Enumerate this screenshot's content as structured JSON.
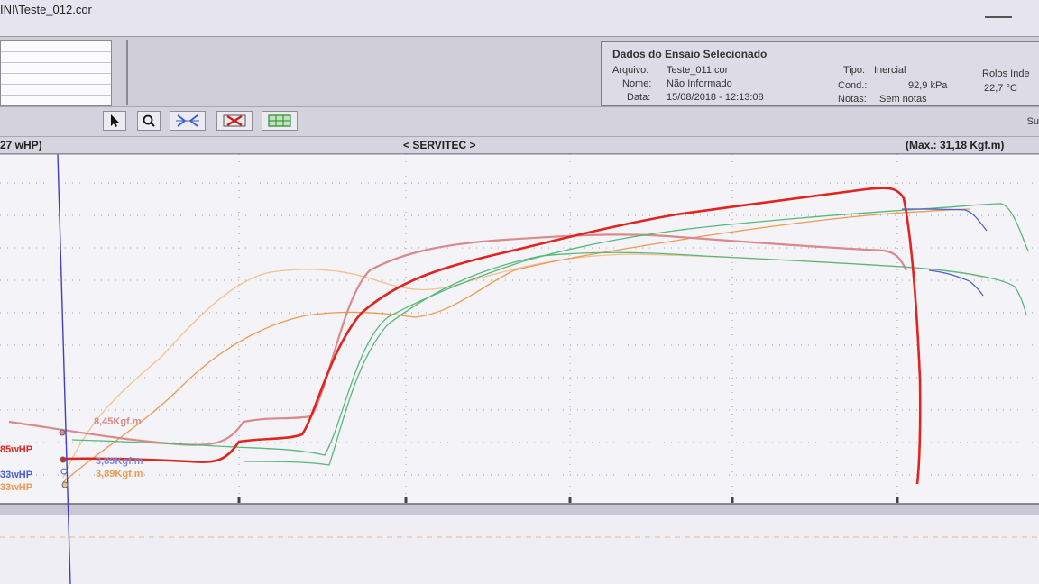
{
  "window": {
    "title": "INI\\Teste_012.cor"
  },
  "info": {
    "heading": "Dados do Ensaio Selecionado",
    "arquivo_label": "Arquivo:",
    "arquivo_value": "Teste_011.cor",
    "nome_label": "Nome:",
    "nome_value": "Não Informado",
    "data_label": "Data:",
    "data_value": "15/08/2018 - 12:13:08",
    "tipo_label": "Tipo:",
    "tipo_value": "Inercial",
    "cond_label": "Cond.:",
    "cond_value": "92,9 kPa",
    "notas_label": "Notas:",
    "notas_value": "Sem notas",
    "rolos_label": "Rolos Inde",
    "temp_value": "22,7 °C"
  },
  "toolbar": {
    "buttons": [
      "pointer-icon",
      "zoom-icon",
      "fit-icon",
      "clear-icon",
      "grid-icon"
    ],
    "right_text": "Su"
  },
  "chart_header": {
    "left": "27 wHP)",
    "center": "< SERVITEC >",
    "right": "(Max.: 31,18 Kgf.m)"
  },
  "colors": {
    "red": "#e0241f",
    "pink": "#d98a8a",
    "green": "#58b87a",
    "orange": "#ef9a50",
    "blue": "#4a5fd0",
    "lightorange": "#f4c08e",
    "cursor": "#4040c0",
    "grid": "#9aa0b0"
  },
  "chart_data": {
    "type": "line",
    "readouts": [
      {
        "label": "8,45Kgf.m",
        "color": "#d98a8a"
      },
      {
        "label": "3,89Kgf.m",
        "color": "#7a8ce0"
      },
      {
        "label": "3,89Kgf.m",
        "color": "#ef9a50"
      },
      {
        "label": "85wHP",
        "color": "#e0241f"
      },
      {
        "label": "33wHP",
        "color": "#4a5fd0"
      },
      {
        "label": "33wHP",
        "color": "#ef9a50"
      }
    ]
  }
}
